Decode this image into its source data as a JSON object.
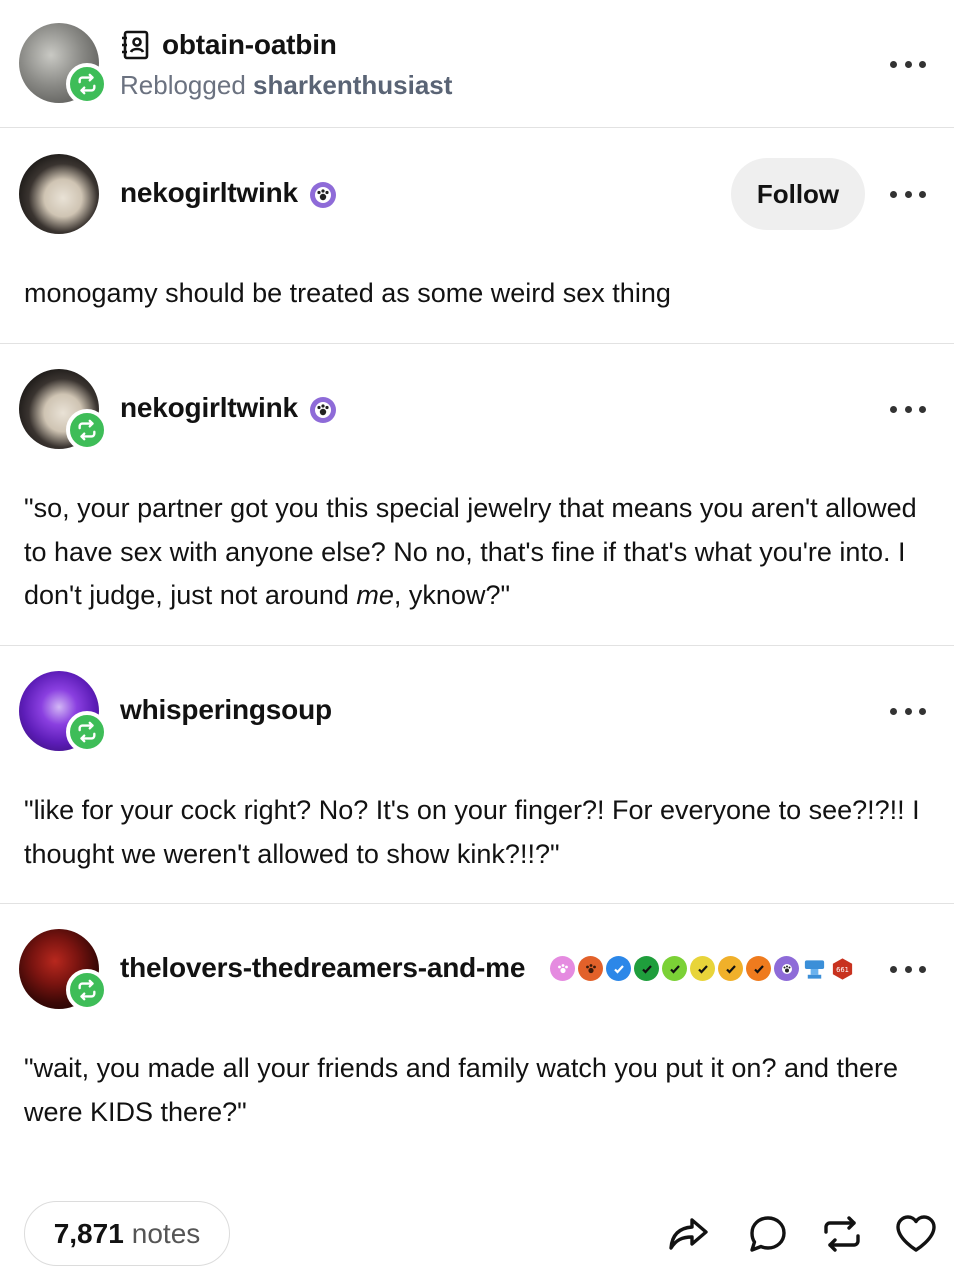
{
  "header": {
    "blog_name": "obtain-oatbin",
    "reblogged_prefix": "Reblogged",
    "reblogged_from": "sharkenthusiast"
  },
  "posts": [
    {
      "username": "nekogirltwink",
      "follow_label": "Follow",
      "text": "monogamy should be treated as some weird sex thing"
    },
    {
      "username": "nekogirltwink",
      "text_before": "\"so, your partner got you this special jewelry that means you aren't allowed to have sex with anyone else? No no, that's fine if that's what you're into. I don't judge, just not around ",
      "text_em": "me",
      "text_after": ", yknow?\""
    },
    {
      "username": "whisperingsoup",
      "text": "\"like for your cock right? No? It's on your finger?! For everyone to see?!?!! I thought we weren't allowed to show kink?!!?\""
    },
    {
      "username": "thelovers-thedreamers-and-me",
      "text": "\"wait, you made all your friends and family watch you put it on? and there were KIDS there?\""
    }
  ],
  "footer": {
    "notes_count": "7,871",
    "notes_label": "notes"
  },
  "icons": {
    "share": "share-icon",
    "reply": "reply-icon",
    "reblog": "reblog-icon",
    "like": "heart-icon",
    "menu": "more-dots-icon"
  },
  "colors": {
    "reblog_green": "#3ebd58",
    "follow_bg": "#efefef",
    "divider": "#e2e2e2"
  }
}
